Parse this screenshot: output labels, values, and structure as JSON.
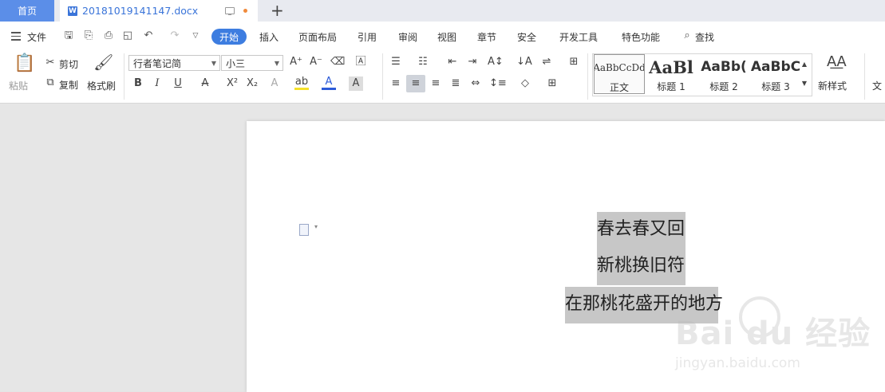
{
  "tabs": {
    "home": "首页",
    "document": "20181019141147.docx",
    "add": "+"
  },
  "menu": {
    "file": "文件",
    "items": [
      "开始",
      "插入",
      "页面布局",
      "引用",
      "审阅",
      "视图",
      "章节",
      "安全",
      "开发工具",
      "特色功能"
    ],
    "search": "查找"
  },
  "ribbon": {
    "paste": "粘贴",
    "cut": "剪切",
    "copy": "复制",
    "format_painter": "格式刷",
    "font_name": "行者笔记简",
    "font_size": "小三",
    "styles": [
      {
        "preview": "AaBbCcDd",
        "label": "正文"
      },
      {
        "preview": "AaBl",
        "label": "标题 1"
      },
      {
        "preview": "AaBb(",
        "label": "标题 2"
      },
      {
        "preview": "AaBbC",
        "label": "标题 3"
      }
    ],
    "new_style": "新样式",
    "more": "文"
  },
  "document": {
    "lines": [
      "春去春又回",
      "新桃换旧符",
      "在那桃花盛开的地方"
    ]
  },
  "watermark": {
    "brand": "Bai du 经验",
    "url": "jingyan.baidu.com"
  },
  "colors": {
    "accent": "#3d7de0",
    "home_tab": "#5b8ee8",
    "selection": "#c7c7c7"
  }
}
